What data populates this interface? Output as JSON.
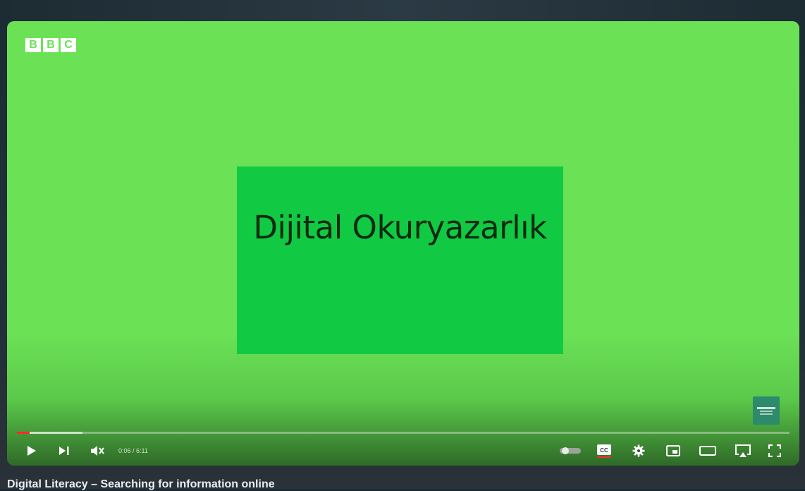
{
  "player": {
    "logo_letters": [
      "B",
      "B",
      "C"
    ],
    "slide_title": "Dijital Okuryazarlık",
    "time_display": "0:06 / 6:11",
    "progress_fraction": 0.016,
    "buffered_fraction": 0.085,
    "accent_color": "#ff2a2a",
    "background_color": "#6be256",
    "card_color": "#12c944",
    "controls": [
      {
        "name": "play-icon"
      },
      {
        "name": "next-icon"
      },
      {
        "name": "volume-muted-icon"
      },
      {
        "name": "autoplay-toggle-icon"
      },
      {
        "name": "subtitles-icon"
      },
      {
        "name": "settings-gear-icon"
      },
      {
        "name": "miniplayer-icon"
      },
      {
        "name": "theater-mode-icon"
      },
      {
        "name": "airplay-icon"
      },
      {
        "name": "fullscreen-icon"
      }
    ]
  },
  "caption": {
    "video_title": "Digital Literacy – Searching for information online"
  }
}
